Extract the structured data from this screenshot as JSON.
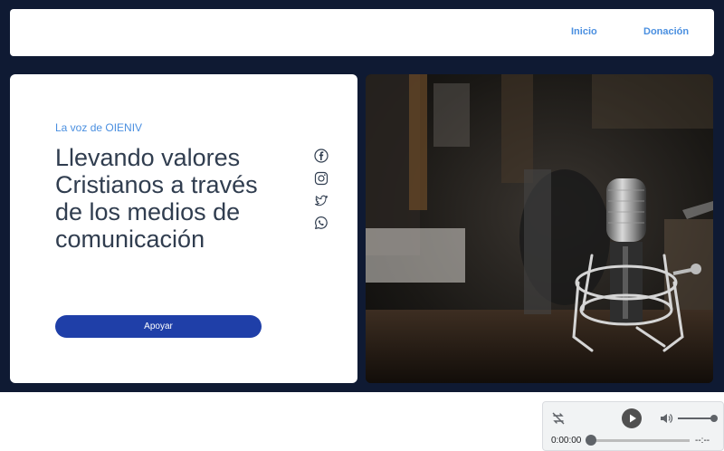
{
  "nav": {
    "links": [
      "Inicio",
      "Donación"
    ]
  },
  "hero": {
    "eyebrow": "La voz de OIENIV",
    "headline": "Llevando valores Cristianos a través de los medios de comunicación",
    "cta_label": "Apoyar"
  },
  "social_icons": [
    "facebook-icon",
    "instagram-icon",
    "twitter-icon",
    "whatsapp-icon"
  ],
  "image": {
    "subject": "studio-microphone-photo"
  },
  "player": {
    "current_time": "0:00:00",
    "duration": "--:--",
    "progress": 0,
    "volume": 1.0
  },
  "colors": {
    "background_dark": "#0f1a33",
    "accent": "#4a8fe0",
    "button": "#1f3fa8",
    "headline": "#303d4f"
  }
}
